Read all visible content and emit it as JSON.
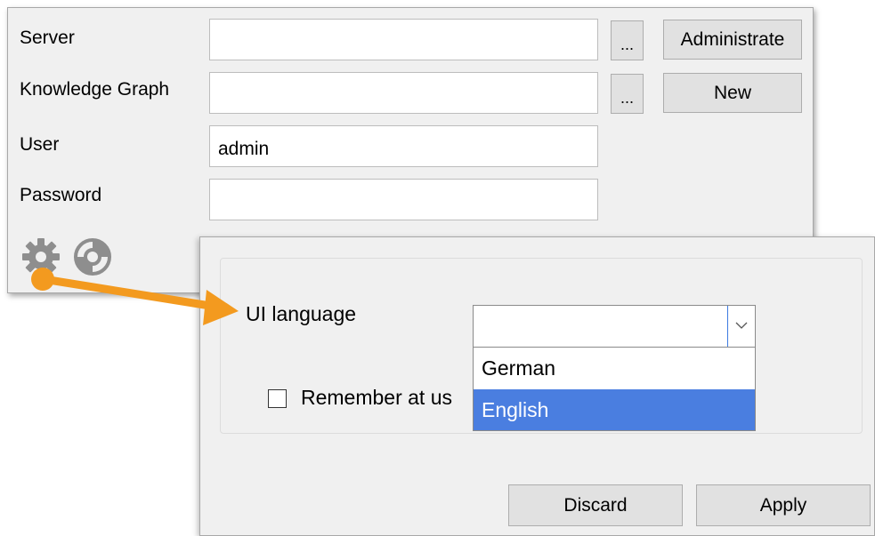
{
  "login": {
    "server_label": "Server",
    "server_value": "",
    "kg_label": "Knowledge Graph",
    "kg_value": "",
    "user_label": "User",
    "user_value": "admin",
    "password_label": "Password",
    "password_value": "",
    "browse_server_label": "...",
    "browse_kg_label": "...",
    "administrate_label": "Administrate",
    "new_label": "New",
    "icons": [
      "gear-icon",
      "lifebuoy-icon"
    ]
  },
  "options": {
    "ui_language_label": "UI language",
    "selected_language": "",
    "language_options": [
      "German",
      "English"
    ],
    "highlighted_option": "English",
    "remember_label": "Remember at us",
    "remember_checked": false,
    "discard_label": "Discard",
    "apply_label": "Apply"
  },
  "colors": {
    "arrow": "#f39a1f",
    "selection": "#4a7ee0",
    "dialog_bg": "#f0f0f0"
  }
}
